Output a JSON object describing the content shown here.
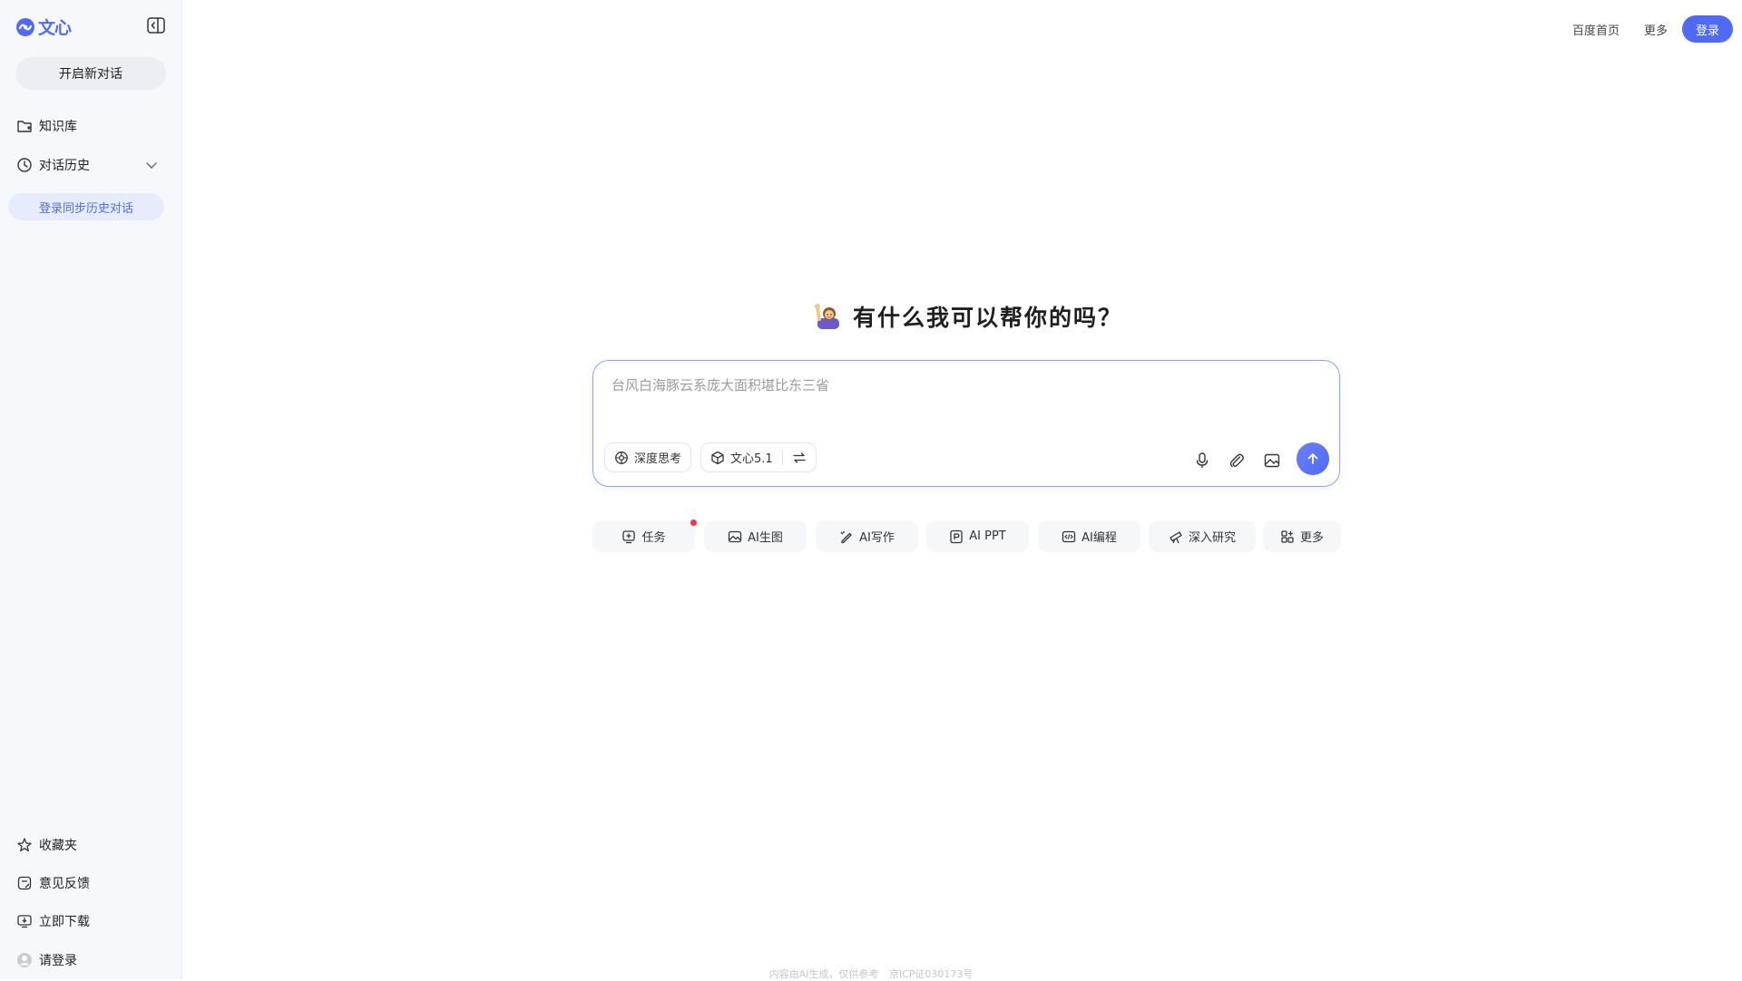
{
  "app": {
    "logo_text": "文心",
    "brand_color": "#4f6bf5"
  },
  "sidebar": {
    "new_chat_label": "开启新对话",
    "items": [
      {
        "label": "知识库",
        "icon": "folder-icon"
      },
      {
        "label": "对话历史",
        "icon": "clock-icon"
      }
    ],
    "login_sync_label": "登录同步历史对话",
    "bottom_items": [
      {
        "label": "收藏夹",
        "icon": "star-icon"
      },
      {
        "label": "意见反馈",
        "icon": "feedback-icon"
      },
      {
        "label": "立即下载",
        "icon": "download-icon"
      },
      {
        "label": "请登录",
        "icon": "avatar-icon"
      }
    ]
  },
  "header": {
    "baidu_home": "百度首页",
    "more": "更多",
    "login": "登录"
  },
  "main": {
    "greeting": "有什么我可以帮你的吗？",
    "input_placeholder": "台风白海豚云系庞大面积堪比东三省",
    "deep_think_label": "深度思考",
    "model_label": "文心5.1",
    "shortcuts": [
      {
        "label": "任务",
        "icon": "task-icon"
      },
      {
        "label": "AI生图",
        "icon": "image-gen-icon"
      },
      {
        "label": "AI写作",
        "icon": "pen-icon"
      },
      {
        "label": "AI PPT",
        "icon": "ppt-icon"
      },
      {
        "label": "AI编程",
        "icon": "code-icon"
      },
      {
        "label": "深入研究",
        "icon": "telescope-icon"
      },
      {
        "label": "更多",
        "icon": "grid-more-icon"
      }
    ]
  },
  "footer": {
    "notice": "内容由AI生成，仅供参考",
    "icp": "京ICP证030173号"
  }
}
